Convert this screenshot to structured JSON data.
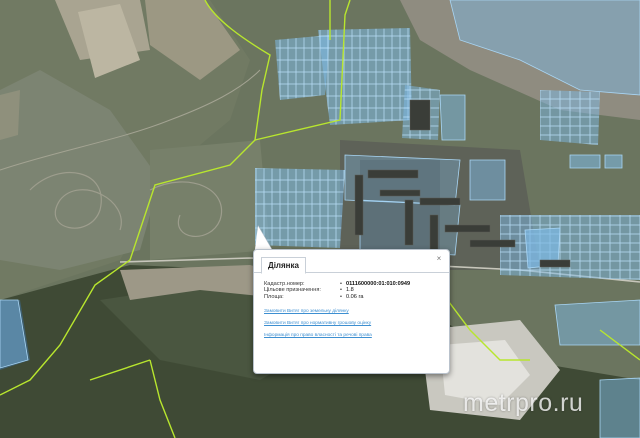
{
  "popup": {
    "tab_label": "Ділянка",
    "close_label": "×",
    "fields": [
      {
        "label": "Кадастр.номер:",
        "value": "0111600000:01:010:0949"
      },
      {
        "label": "Цільове призначення:",
        "value": "1.8"
      },
      {
        "label": "Площа:",
        "value": "0.06 га"
      }
    ],
    "links": [
      "Замовити Витяг про земельну ділянку",
      "Замовити Витяг про нормативну грошову оцінку",
      "Інформація про право власності та речові права"
    ]
  },
  "map": {
    "imagery": "satellite",
    "watermark": "metrpro.ru",
    "colors": {
      "parcel_fill": "#7db9e6",
      "parcel_stroke": "#a9d6f5",
      "boundary_line": "#b8e62e",
      "link": "#3d8fd1"
    }
  }
}
